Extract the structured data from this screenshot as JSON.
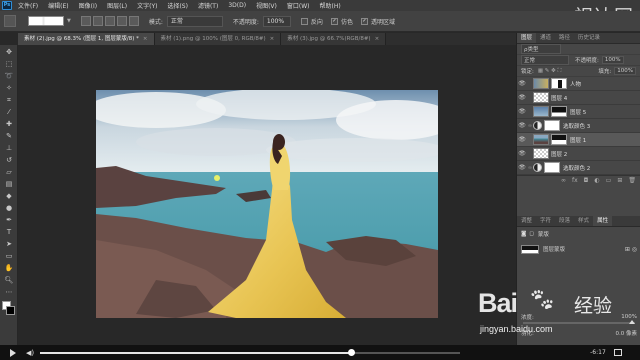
{
  "app": {
    "logo": "Ps"
  },
  "menu": [
    "文件(F)",
    "编辑(E)",
    "图像(I)",
    "图层(L)",
    "文字(Y)",
    "选择(S)",
    "滤镜(T)",
    "3D(D)",
    "视图(V)",
    "窗口(W)",
    "帮助(H)"
  ],
  "options": {
    "mode_label": "模式:",
    "mode_value": "正常",
    "opacity_label": "不透明度:",
    "opacity_value": "100%",
    "reverse_label": "反向",
    "dither_label": "仿色",
    "transparency_label": "透明区域"
  },
  "watermark_top": "视达网",
  "tabs": [
    {
      "label": "素材 (2).jpg @ 68.3% (图层 1, 图层蒙版/8) *",
      "active": true
    },
    {
      "label": "素材 (1).png @ 100% (图层 0, RGB/8#)",
      "active": false
    },
    {
      "label": "素材 (3).jpg @ 66.7%(RGB/8#)",
      "active": false
    }
  ],
  "panel": {
    "tabs": [
      "图层",
      "通道",
      "路径",
      "历史记录"
    ],
    "filter_label": "ρ类型",
    "blend_mode": "正常",
    "opacity_label": "不透明度:",
    "opacity_value": "100%",
    "lock_label": "锁定:",
    "fill_label": "填充:",
    "fill_value": "100%",
    "layers": [
      {
        "name": "人物",
        "thumb": "person",
        "mask": "black-figure",
        "selected": false,
        "adj": false
      },
      {
        "name": "图层 4",
        "thumb": "checker",
        "mask": "",
        "selected": false,
        "adj": false
      },
      {
        "name": "图层 5",
        "thumb": "sky",
        "mask": "dark",
        "selected": false,
        "adj": false
      },
      {
        "name": "选取颜色 3",
        "thumb": "",
        "mask": "white",
        "selected": false,
        "adj": true
      },
      {
        "name": "图层 1",
        "thumb": "photo",
        "mask": "dark",
        "selected": true,
        "adj": false
      },
      {
        "name": "图层 2",
        "thumb": "checker",
        "mask": "",
        "selected": false,
        "adj": false
      },
      {
        "name": "选取颜色 2",
        "thumb": "",
        "mask": "white",
        "selected": false,
        "adj": true
      }
    ],
    "props_tabs": [
      "调整",
      "字符",
      "段落",
      "样式",
      "属性"
    ],
    "props_title": "蒙版",
    "mask_label": "图层蒙版",
    "density_label": "浓度:",
    "density_value": "100%",
    "feather_label": "羽化:",
    "feather_value": "0.0 像素"
  },
  "video": {
    "time": "-6:17",
    "progress": 0.74
  },
  "baidu": {
    "text": "Bai",
    "cn": "经验",
    "url": "jingyan.baidu.com"
  }
}
